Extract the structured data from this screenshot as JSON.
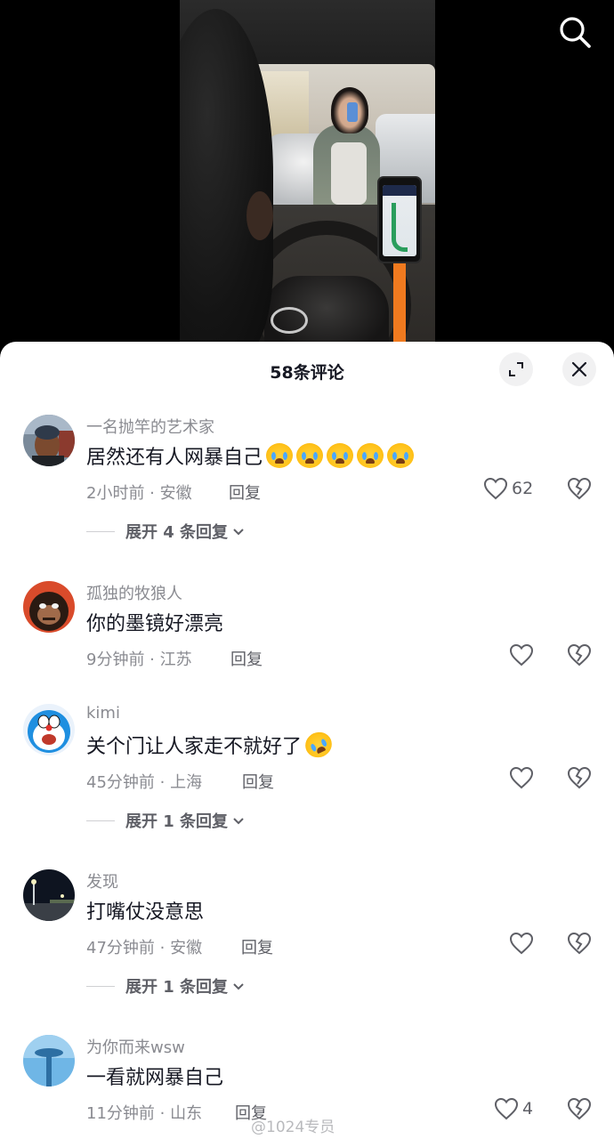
{
  "header": {
    "comment_count": "58条评论"
  },
  "comments": [
    {
      "username": "一名抛竿的艺术家",
      "text": "居然还有人网暴自己",
      "emojis": [
        "crying-laughing",
        "crying-laughing",
        "crying-laughing",
        "crying-laughing",
        "crying-laughing"
      ],
      "time_location": "2小时前 · 安徽",
      "reply_label": "回复",
      "likes": "62",
      "expand_label": "展开 4 条回复"
    },
    {
      "username": "孤独的牧狼人",
      "text": "你的墨镜好漂亮",
      "time_location": "9分钟前 · 江苏",
      "reply_label": "回复",
      "likes": ""
    },
    {
      "username": "kimi",
      "text": "关个门让人家走不就好了",
      "emojis": [
        "rolling-laughing"
      ],
      "time_location": "45分钟前 · 上海",
      "reply_label": "回复",
      "likes": "",
      "expand_label": "展开 1 条回复"
    },
    {
      "username": "发现",
      "text": "打嘴仗没意思",
      "time_location": "47分钟前 · 安徽",
      "reply_label": "回复",
      "likes": "",
      "expand_label": "展开 1 条回复"
    },
    {
      "username": "为你而来wsw",
      "text": "一看就网暴自己",
      "time_location": "11分钟前 · 山东",
      "reply_label": "回复",
      "likes": "4"
    }
  ],
  "watermark": "@1024专员",
  "icons": {
    "search": "search-icon",
    "expand": "expand-icon",
    "close": "close-icon",
    "like": "heart-icon",
    "dislike": "broken-heart-icon",
    "chevron": "chevron-down-icon"
  }
}
